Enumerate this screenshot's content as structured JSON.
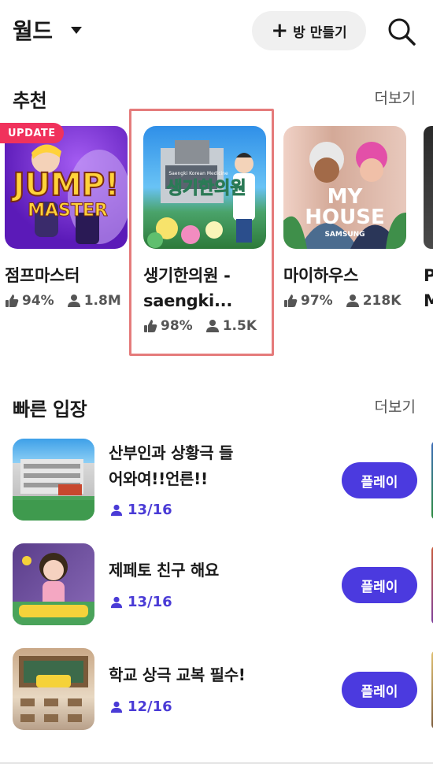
{
  "header": {
    "title": "월드",
    "create_label": "방 만들기"
  },
  "recommended": {
    "title": "추천",
    "more": "더보기",
    "update_badge": "UPDATE",
    "cards": [
      {
        "name": "점프마스터",
        "like": "94%",
        "users": "1.8M"
      },
      {
        "name": "생기한의원 -\nsaengki...",
        "like": "98%",
        "users": "1.5K"
      },
      {
        "name": "마이하우스",
        "like": "97%",
        "users": "218K"
      },
      {
        "name": "P\nM",
        "like": "",
        "users": ""
      }
    ],
    "thumb_text": {
      "jump_1": "JUMP!",
      "jump_2": "MASTER",
      "saengki_sub": "Saengki Korean Medicine",
      "saengki_main": "생기한의원",
      "house_1": "MY",
      "house_2": "HOUSE",
      "house_3": "SAMSUNG"
    }
  },
  "quick": {
    "title": "빠른 입장",
    "more": "더보기",
    "play_label": "플레이",
    "rows": [
      {
        "title": "산부인과 상황극 들어와여!!언른!!",
        "count": "13/16"
      },
      {
        "title": "제페토 친구 해요",
        "count": "13/16"
      },
      {
        "title": "학교 상극 교복 필수!",
        "count": "12/16"
      }
    ]
  },
  "colors": {
    "accent": "#4b3adf",
    "update_badge": "#f0325c",
    "highlight": "#e57b7b"
  }
}
